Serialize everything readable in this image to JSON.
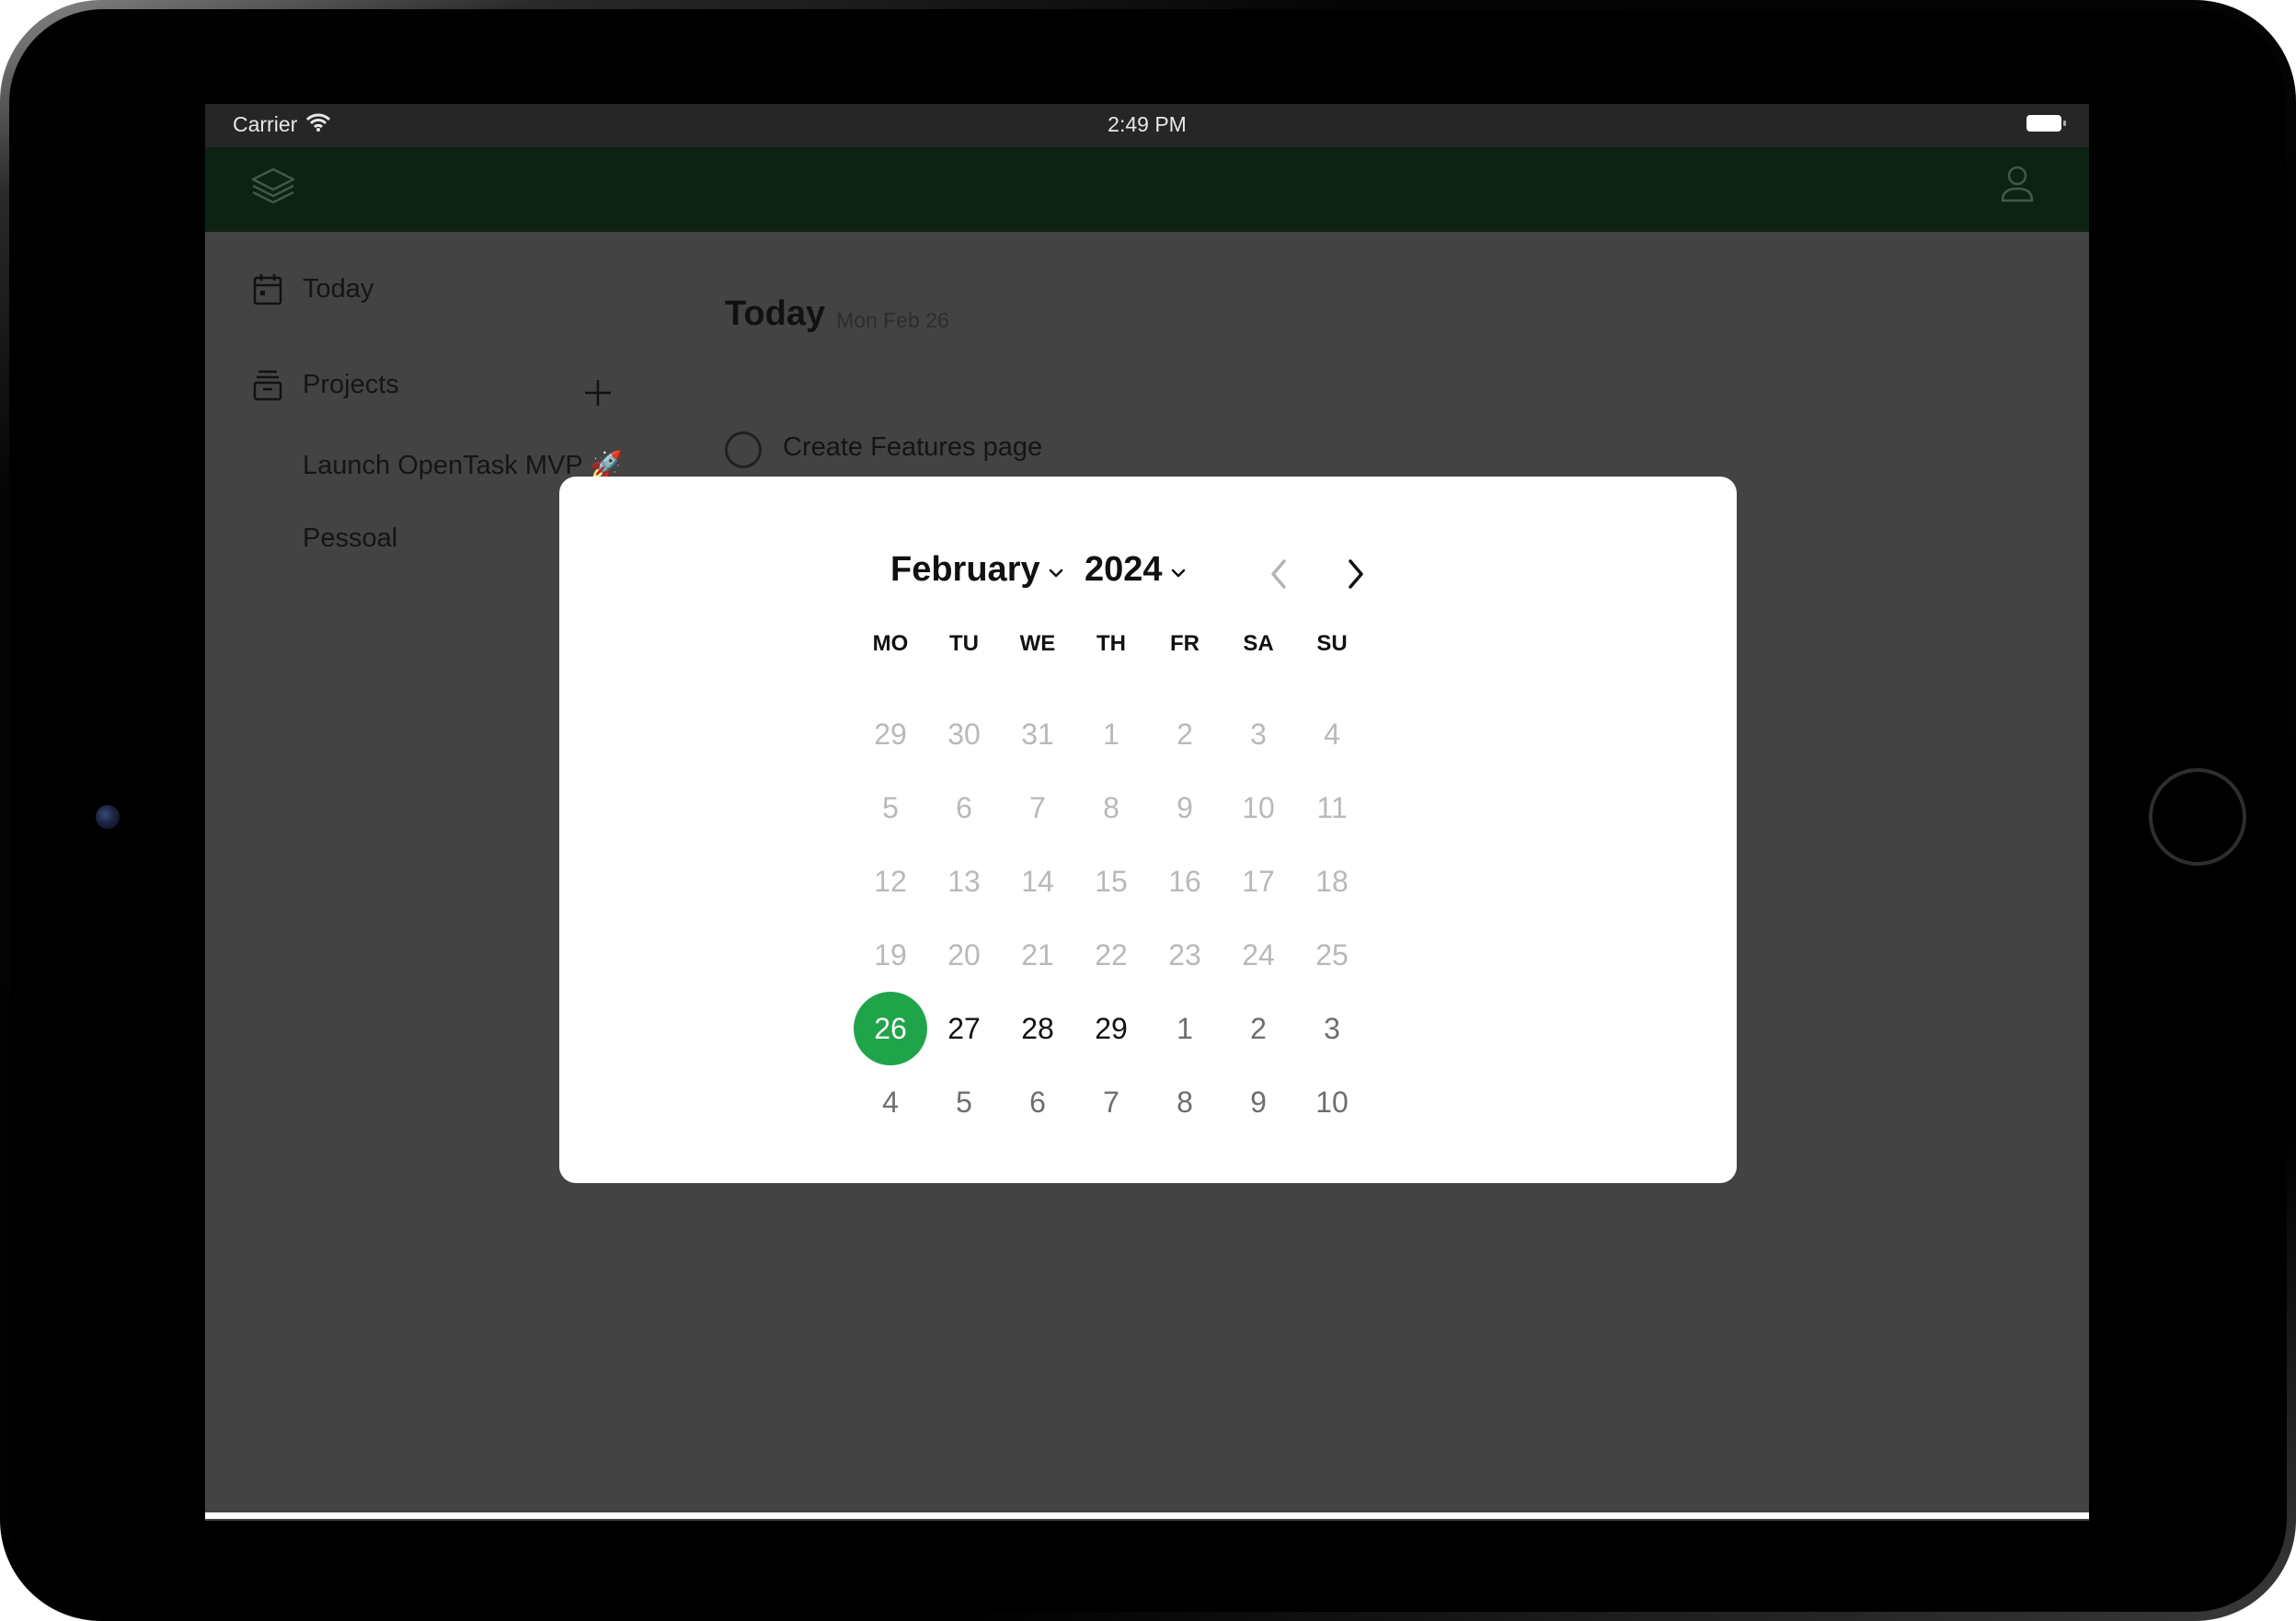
{
  "status_bar": {
    "carrier": "Carrier",
    "time": "2:49 PM"
  },
  "app_bar": {
    "logo_icon": "layers-icon",
    "account_icon": "user-icon"
  },
  "sidebar": {
    "today_label": "Today",
    "projects_label": "Projects",
    "projects": [
      {
        "label": "Launch OpenTask MVP 🚀"
      },
      {
        "label": "Pessoal"
      }
    ]
  },
  "main": {
    "title": "Today",
    "date": "Mon Feb 26",
    "tasks": [
      {
        "label": "Create Features page"
      }
    ]
  },
  "date_picker": {
    "month": "February",
    "year": "2024",
    "weekdays": [
      "MO",
      "TU",
      "WE",
      "TH",
      "FR",
      "SA",
      "SU"
    ],
    "selected_day": "26",
    "accent_color": "#1fa44a",
    "weeks": [
      [
        "29",
        "30",
        "31",
        "1",
        "2",
        "3",
        "4"
      ],
      [
        "5",
        "6",
        "7",
        "8",
        "9",
        "10",
        "11"
      ],
      [
        "12",
        "13",
        "14",
        "15",
        "16",
        "17",
        "18"
      ],
      [
        "19",
        "20",
        "21",
        "22",
        "23",
        "24",
        "25"
      ],
      [
        "26",
        "27",
        "28",
        "29",
        "1",
        "2",
        "3"
      ],
      [
        "4",
        "5",
        "6",
        "7",
        "8",
        "9",
        "10"
      ]
    ]
  }
}
